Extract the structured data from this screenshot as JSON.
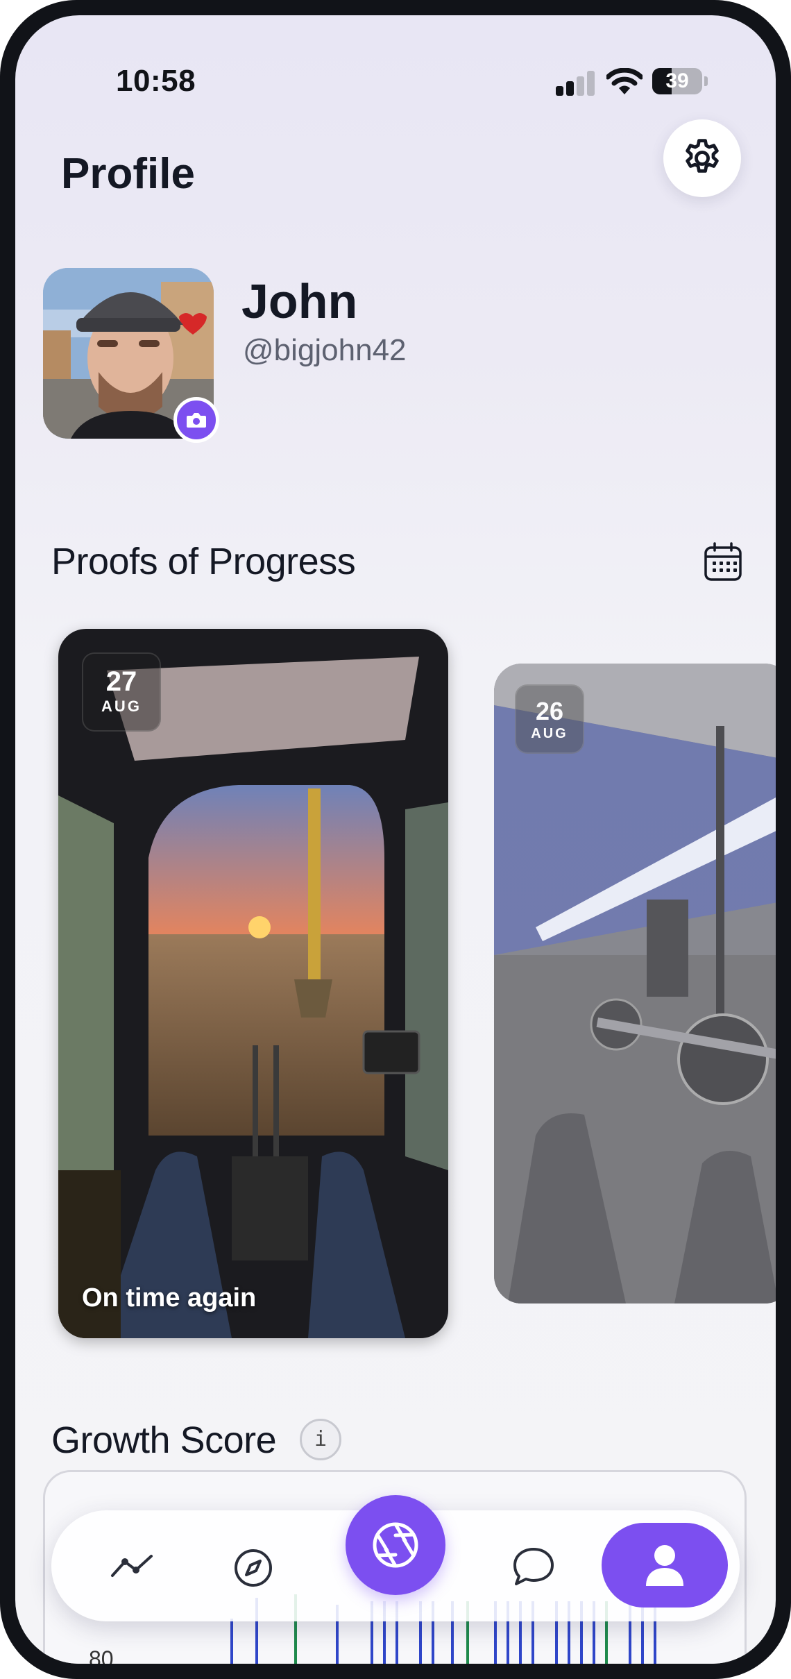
{
  "status_bar": {
    "time": "10:58",
    "battery": "39",
    "battery_level": 0.39
  },
  "header": {
    "title": "Profile"
  },
  "profile": {
    "name": "John",
    "handle": "@bigjohn42"
  },
  "progress": {
    "title": "Proofs of Progress",
    "cards": [
      {
        "day": "27",
        "month": "AUG",
        "caption": "On time again"
      },
      {
        "day": "26",
        "month": "AUG"
      }
    ]
  },
  "growth": {
    "title": "Growth Score",
    "info": "i",
    "axis_label": "80"
  },
  "colors": {
    "accent": "#7c4ff0",
    "text": "#141824",
    "muted": "#5d6170"
  },
  "nav": {
    "items": [
      {
        "icon": "chart-line-icon"
      },
      {
        "icon": "compass-icon"
      },
      {
        "icon": "camera-aperture-icon"
      },
      {
        "icon": "chat-bubble-icon"
      },
      {
        "icon": "user-icon"
      }
    ],
    "active": "user-icon"
  }
}
